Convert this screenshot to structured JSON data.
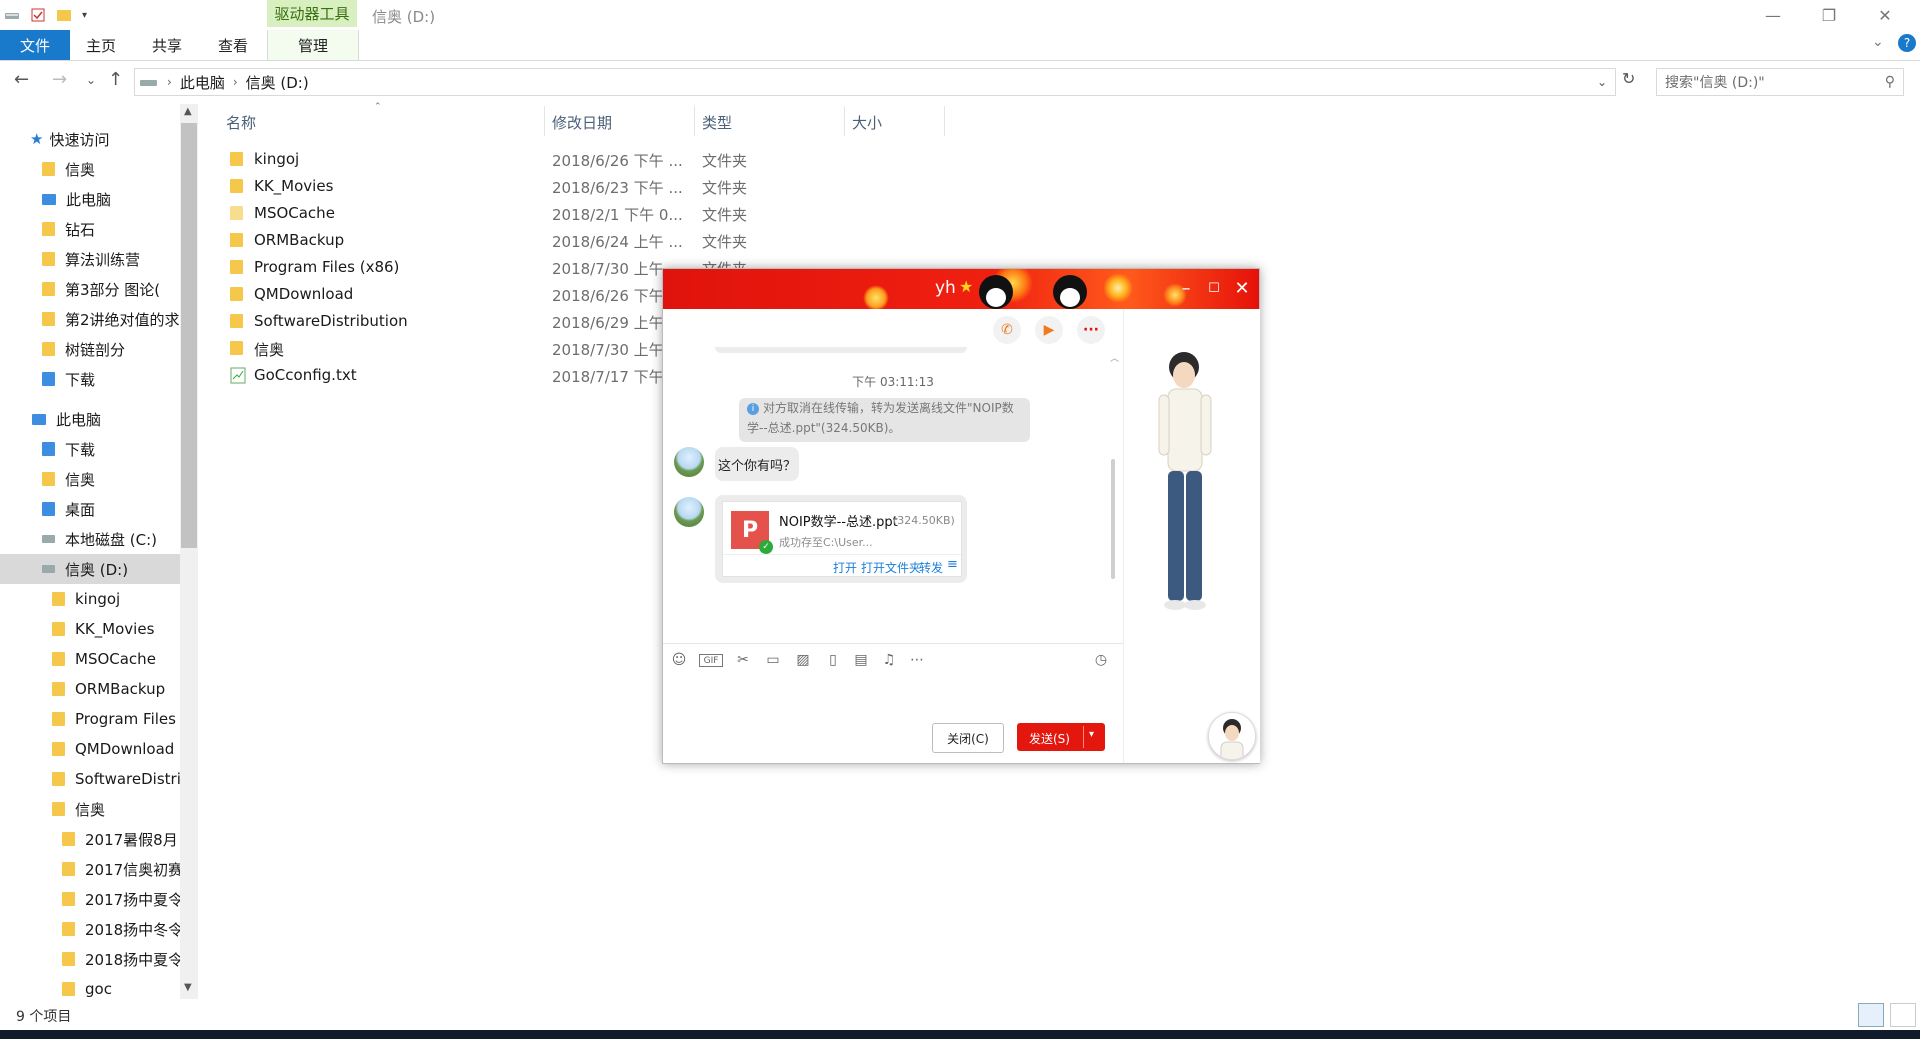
{
  "window": {
    "title": "信奥 (D:)",
    "context_tab_label": "驱动器工具",
    "controls": {
      "minimize": "—",
      "maximize": "❐",
      "close": "✕"
    }
  },
  "ribbon": {
    "tabs": [
      {
        "label": "文件"
      },
      {
        "label": "主页"
      },
      {
        "label": "共享"
      },
      {
        "label": "查看"
      },
      {
        "label": "管理"
      }
    ]
  },
  "address": {
    "path": [
      "此电脑",
      "信奥 (D:)"
    ],
    "search_placeholder": "搜索\"信奥 (D:)\""
  },
  "nav": {
    "quick_access": "快速访问",
    "items": [
      {
        "label": "快速访问",
        "icon": "star-icon"
      },
      {
        "label": "信奥",
        "icon": "folder-icon",
        "pinned": true
      },
      {
        "label": "此电脑",
        "icon": "computer-icon",
        "pinned": true
      },
      {
        "label": "钻石",
        "icon": "folder-icon",
        "pinned": true
      },
      {
        "label": "算法训练营",
        "icon": "folder-icon",
        "pinned": true
      },
      {
        "label": "第3部分 图论(",
        "icon": "folder-icon",
        "pinned": true
      },
      {
        "label": "第2讲绝对值的求",
        "icon": "folder-icon"
      },
      {
        "label": "树链剖分",
        "icon": "folder-icon"
      },
      {
        "label": "下载",
        "icon": "download-folder-icon"
      },
      {
        "label": "此电脑",
        "icon": "computer-icon"
      },
      {
        "label": "下载",
        "icon": "download-folder-icon"
      },
      {
        "label": "信奥",
        "icon": "folder-icon"
      },
      {
        "label": "桌面",
        "icon": "desktop-folder-icon"
      },
      {
        "label": "本地磁盘 (C:)",
        "icon": "drive-icon"
      },
      {
        "label": "信奥 (D:)",
        "icon": "drive-icon",
        "selected": true
      },
      {
        "label": "kingoj",
        "icon": "folder-icon"
      },
      {
        "label": "KK_Movies",
        "icon": "folder-icon"
      },
      {
        "label": "MSOCache",
        "icon": "folder-icon"
      },
      {
        "label": "ORMBackup",
        "icon": "folder-icon"
      },
      {
        "label": "Program Files",
        "icon": "folder-icon"
      },
      {
        "label": "QMDownload",
        "icon": "folder-icon"
      },
      {
        "label": "SoftwareDistri",
        "icon": "folder-icon"
      },
      {
        "label": "信奥",
        "icon": "folder-icon"
      },
      {
        "label": "2017暑假8月",
        "icon": "folder-icon"
      },
      {
        "label": "2017信奥初赛",
        "icon": "folder-icon"
      },
      {
        "label": "2017扬中夏令",
        "icon": "folder-icon"
      },
      {
        "label": "2018扬中冬令",
        "icon": "folder-icon"
      },
      {
        "label": "2018扬中夏令",
        "icon": "folder-icon"
      },
      {
        "label": "goc",
        "icon": "folder-icon"
      }
    ]
  },
  "columns": {
    "name": "名称",
    "date": "修改日期",
    "type": "类型",
    "size": "大小"
  },
  "files": [
    {
      "name": "kingoj",
      "date": "2018/6/26 下午 ...",
      "type": "文件夹",
      "icon": "folder-icon"
    },
    {
      "name": "KK_Movies",
      "date": "2018/6/23 下午 ...",
      "type": "文件夹",
      "icon": "folder-icon"
    },
    {
      "name": "MSOCache",
      "date": "2018/2/1 下午 0...",
      "type": "文件夹",
      "icon": "folder-icon"
    },
    {
      "name": "ORMBackup",
      "date": "2018/6/24 上午 ...",
      "type": "文件夹",
      "icon": "folder-icon"
    },
    {
      "name": "Program Files (x86)",
      "date": "2018/7/30 上午",
      "type": "文件夹",
      "icon": "folder-icon"
    },
    {
      "name": "QMDownload",
      "date": "2018/6/26 下午",
      "type": "",
      "icon": "folder-icon"
    },
    {
      "name": "SoftwareDistribution",
      "date": "2018/6/29 上午",
      "type": "",
      "icon": "folder-icon"
    },
    {
      "name": "信奥",
      "date": "2018/7/30 上午",
      "type": "",
      "icon": "folder-icon"
    },
    {
      "name": "GoCconfig.txt",
      "date": "2018/7/17 下午",
      "type": "",
      "icon": "text-file-icon"
    }
  ],
  "status": {
    "count": "9 个项目"
  },
  "qq": {
    "contact_name": "yh",
    "time": "下午 03:11:13",
    "notice": "对方取消在线传输，转为发送离线文件\"NOIP数学--总述.ppt\"(324.50KB)。",
    "message": "这个你有吗？",
    "file": {
      "name": "NOIP数学--总述.ppt",
      "size": "(324.50KB)",
      "saved": "成功存至C:\\User...",
      "actions": [
        "打开",
        "打开文件夹",
        "转发"
      ]
    },
    "close_label": "关闭(C)",
    "send_label": "发送(S)",
    "icons": {
      "toolbar": [
        "phone-icon",
        "video-call-icon",
        "more-icon"
      ],
      "input": [
        "emoji-icon",
        "gif-icon",
        "scissors-icon",
        "folder-icon",
        "image-icon",
        "shake-icon",
        "red-packet-icon",
        "music-icon",
        "more-icon",
        "history-icon"
      ]
    },
    "colors": {
      "header": "#e0130c",
      "send": "#e3170d",
      "link": "#1d7fd8"
    }
  }
}
